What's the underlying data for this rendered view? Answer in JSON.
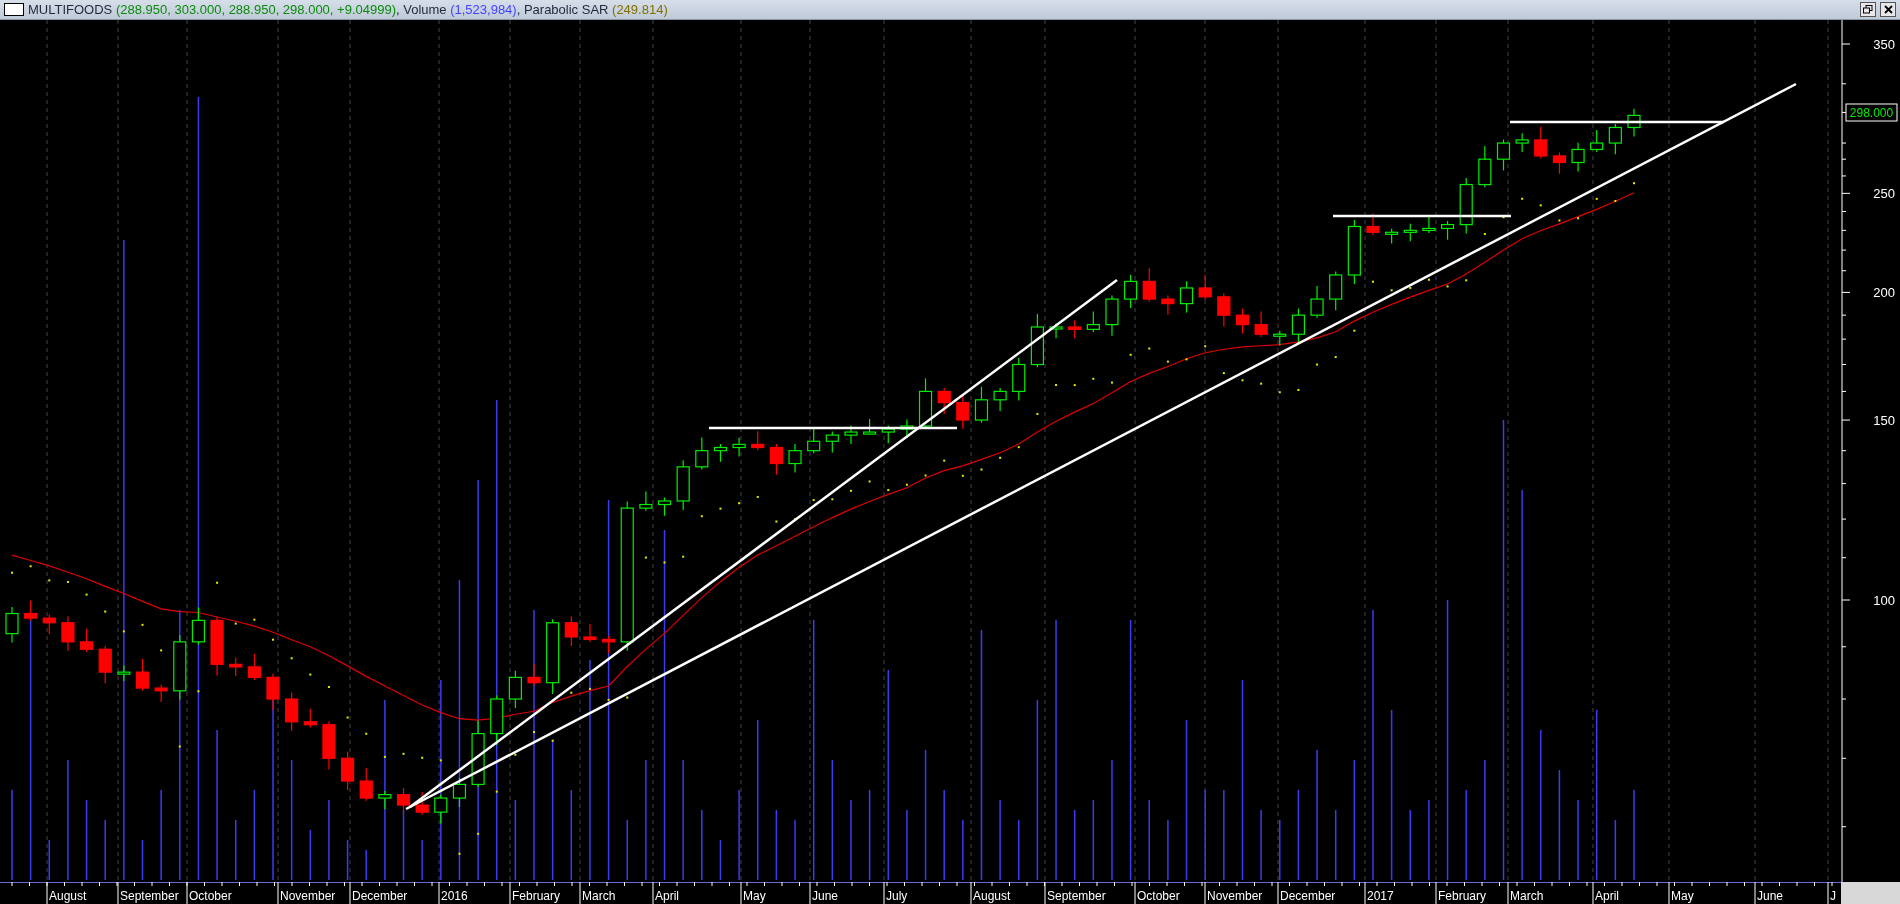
{
  "window": {
    "title_segments": [
      {
        "text": "MULTIFOODS",
        "color": "#1e2a3a"
      },
      {
        "text": "(288.950, 303.000, 288.950, 298.000, +9.04999)",
        "color": "#0a8a0a"
      },
      {
        "text": ", Volume",
        "color": "#1e2a3a"
      },
      {
        "text": "(1,523,984)",
        "color": "#4444ff"
      },
      {
        "text": ", Parabolic SAR",
        "color": "#1e2a3a"
      },
      {
        "text": "(249.814)",
        "color": "#807000"
      }
    ]
  },
  "y_axis": {
    "labels": [
      "350",
      "250",
      "200",
      "150",
      "100"
    ],
    "last_price": "298.000"
  },
  "x_axis": {
    "labels": [
      "August",
      "September",
      "October",
      "November",
      "December",
      "2016",
      "February",
      "March",
      "April",
      "May",
      "June",
      "July",
      "August",
      "September",
      "October",
      "November",
      "December",
      "2017",
      "February",
      "March",
      "April",
      "May",
      "June",
      "J"
    ]
  }
}
